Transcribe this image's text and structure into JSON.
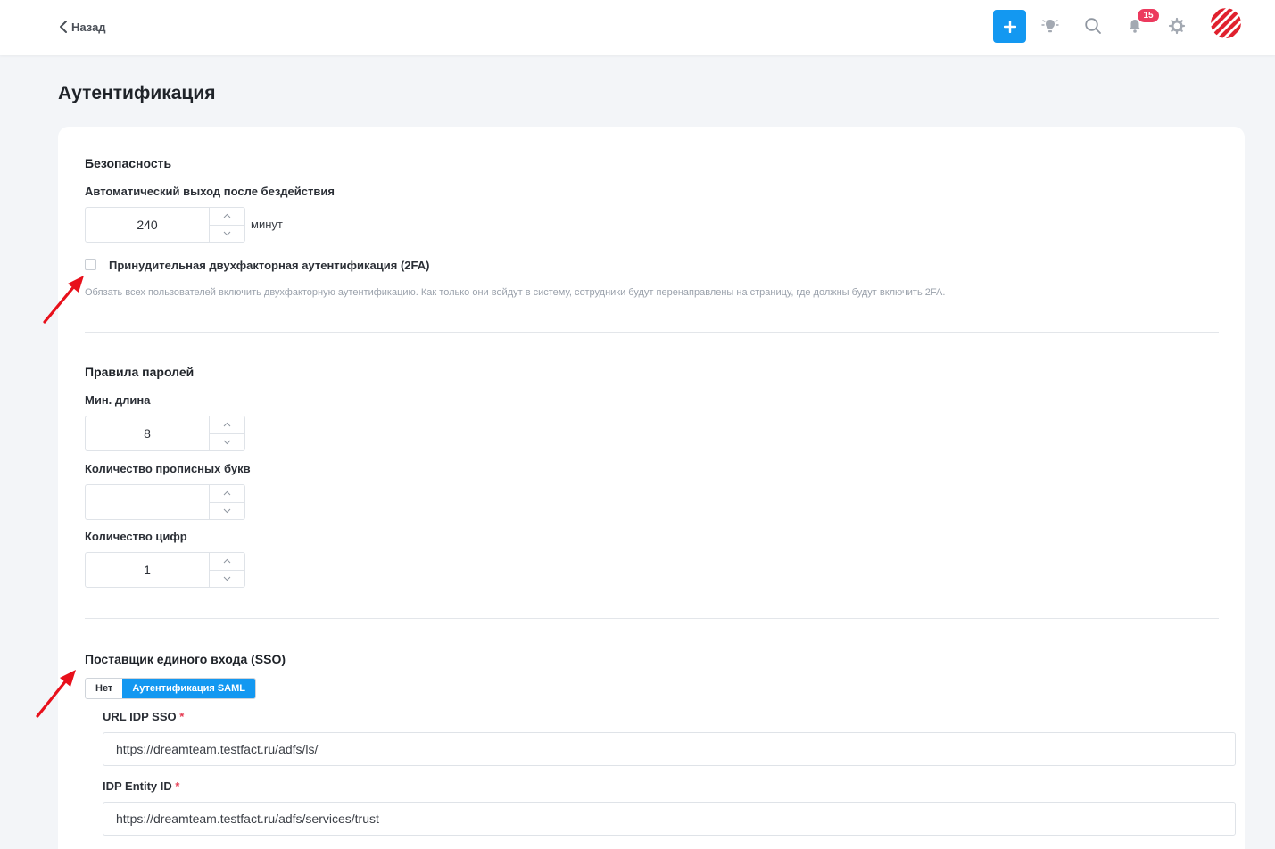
{
  "header": {
    "back_label": "Назад",
    "notifications_count": "15",
    "icons": [
      "plus-icon",
      "lightbulb-icon",
      "search-icon",
      "bell-icon",
      "gear-icon"
    ]
  },
  "page": {
    "title": "Аутентификация"
  },
  "security": {
    "title": "Безопасность",
    "auto_logout_label": "Автоматический выход после бездействия",
    "auto_logout_value": "240",
    "auto_logout_unit": "минут",
    "twofa_label": "Принудительная двухфакторная аутентификация (2FA)",
    "twofa_checked": false,
    "twofa_hint": "Обязать всех пользователей включить двухфакторную аутентификацию. Как только они войдут в систему, сотрудники будут перенаправлены на страницу, где должны будут включить 2FA."
  },
  "password_rules": {
    "title": "Правила паролей",
    "min_length_label": "Мин. длина",
    "min_length_value": "8",
    "uppercase_label": "Количество прописных букв",
    "uppercase_value": "",
    "digits_label": "Количество цифр",
    "digits_value": "1"
  },
  "sso": {
    "title": "Поставщик единого входа (SSO)",
    "options": [
      "Нет",
      "Аутентификация SAML"
    ],
    "selected": "Аутентификация SAML",
    "idp_sso_url_label": "URL IDP SSO",
    "idp_sso_url_value": "https://dreamteam.testfact.ru/adfs/ls/",
    "idp_entity_id_label": "IDP Entity ID",
    "idp_entity_id_value": "https://dreamteam.testfact.ru/adfs/services/trust",
    "required_mark": "*"
  },
  "colors": {
    "accent": "#1398f1",
    "badge": "#ec3a5e",
    "annotation_arrow": "#e8101b",
    "avatar_stripes": "#e0212e"
  }
}
